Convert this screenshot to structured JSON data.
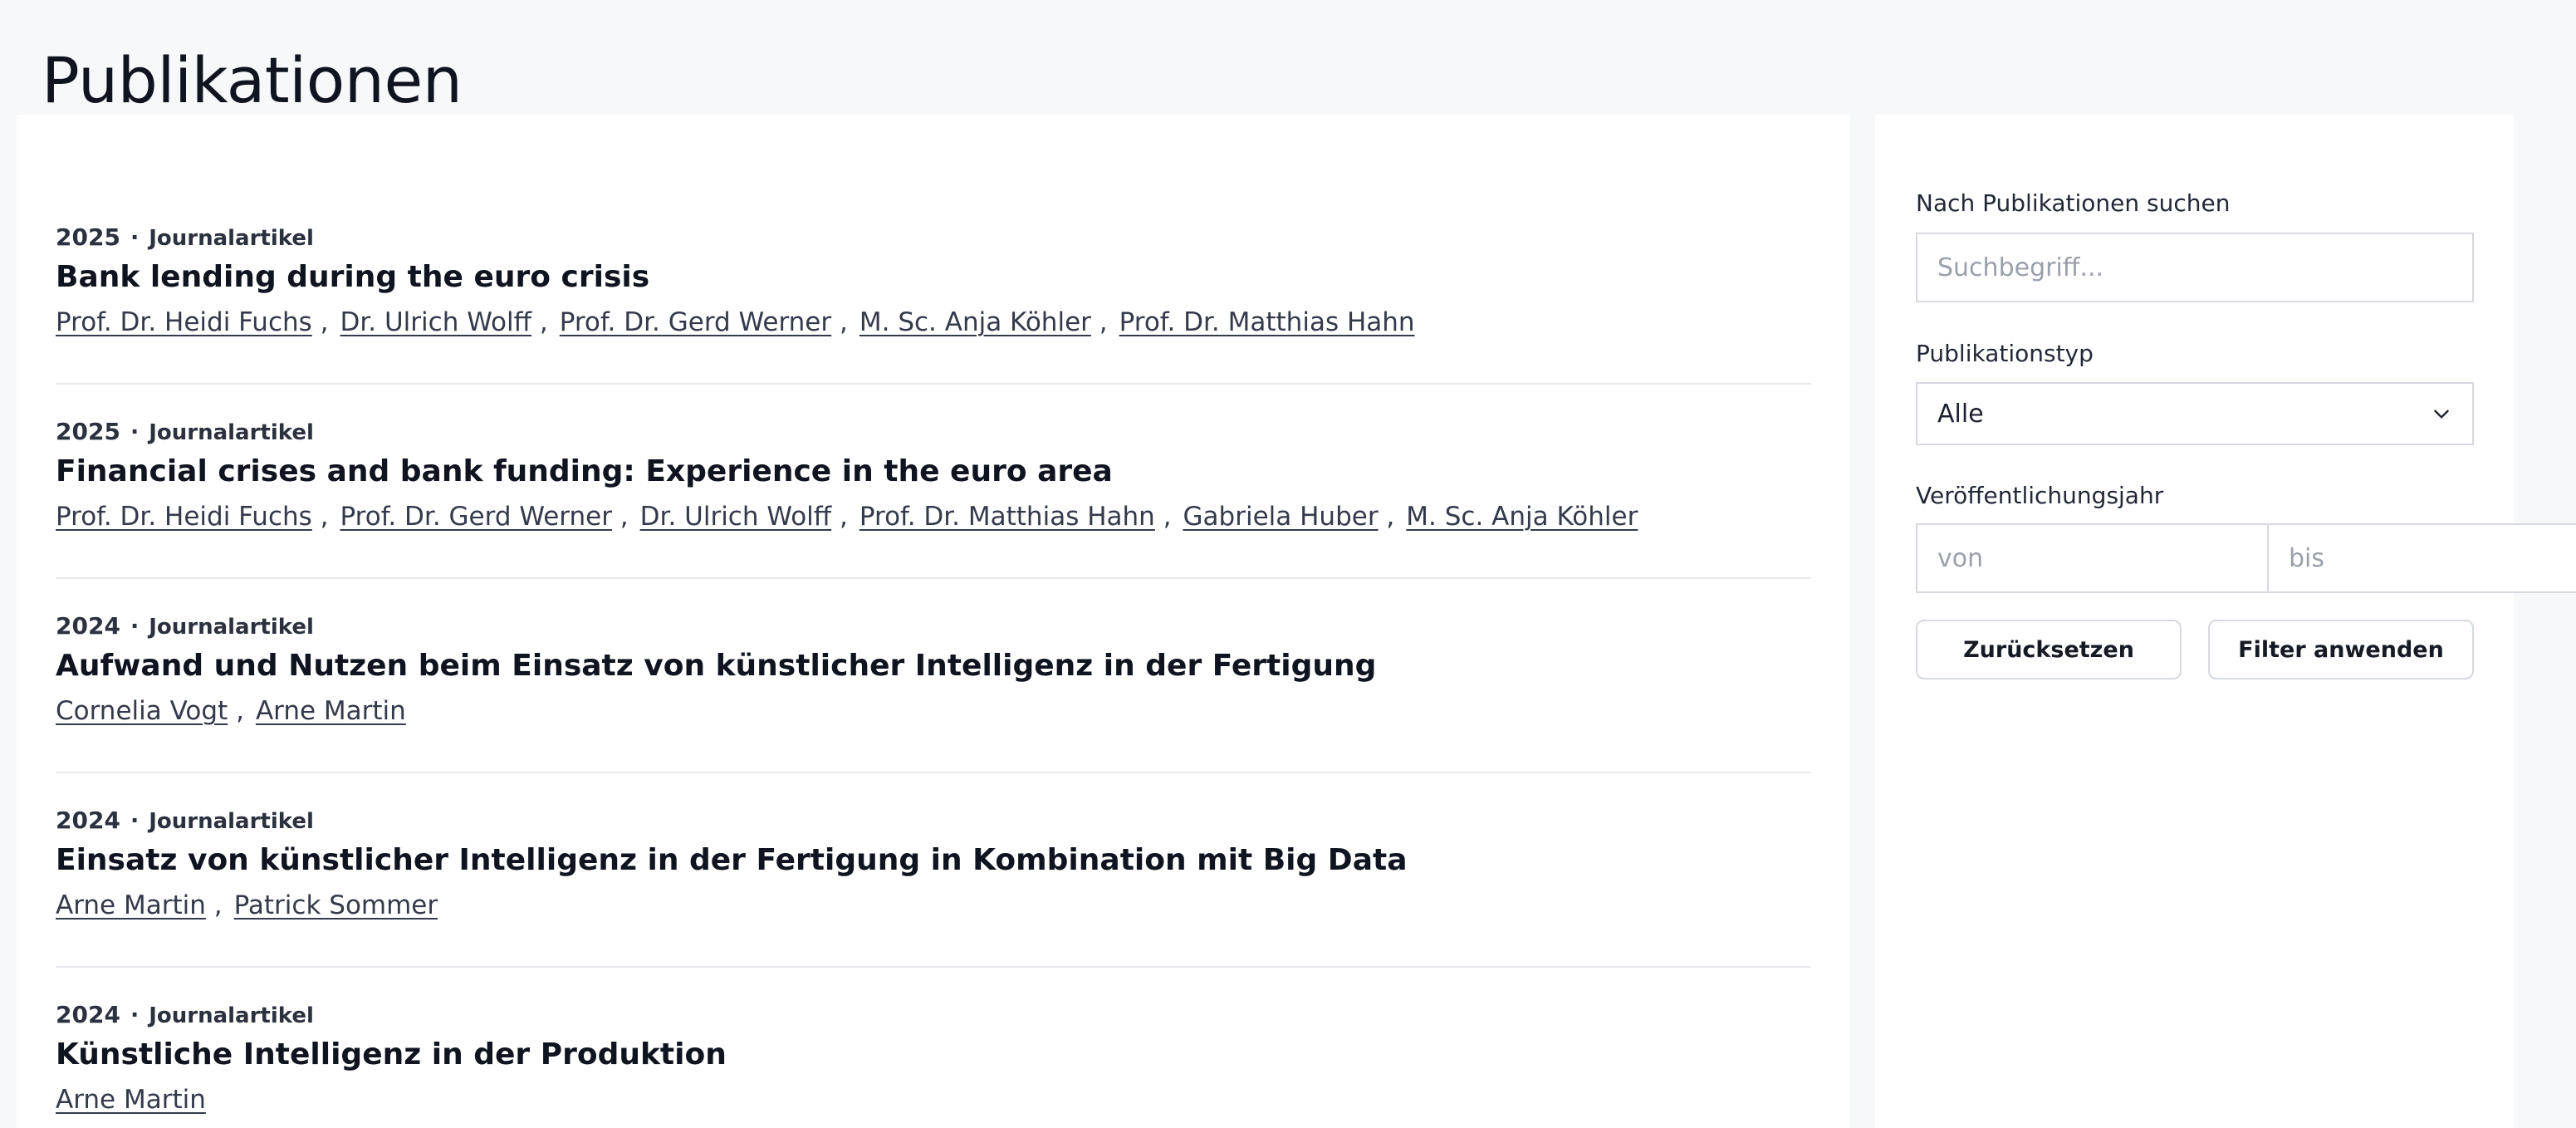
{
  "page": {
    "title": "Publikationen"
  },
  "publications": [
    {
      "year": "2025",
      "type": "Journalartikel",
      "title": "Bank lending during the euro crisis",
      "authors": [
        "Prof. Dr. Heidi Fuchs",
        "Dr. Ulrich Wolff",
        "Prof. Dr. Gerd Werner",
        "M. Sc. Anja Köhler",
        "Prof. Dr. Matthias Hahn"
      ]
    },
    {
      "year": "2025",
      "type": "Journalartikel",
      "title": "Financial crises and bank funding: Experience in the euro area",
      "authors": [
        "Prof. Dr. Heidi Fuchs",
        "Prof. Dr. Gerd Werner",
        "Dr. Ulrich Wolff",
        "Prof. Dr. Matthias Hahn",
        "Gabriela Huber",
        "M. Sc. Anja Köhler"
      ]
    },
    {
      "year": "2024",
      "type": "Journalartikel",
      "title": "Aufwand und Nutzen beim Einsatz von künstlicher Intelligenz in der Fertigung",
      "authors": [
        "Cornelia Vogt",
        "Arne Martin"
      ]
    },
    {
      "year": "2024",
      "type": "Journalartikel",
      "title": "Einsatz von künstlicher Intelligenz in der Fertigung in Kombination mit Big Data",
      "authors": [
        "Arne Martin",
        "Patrick Sommer"
      ]
    },
    {
      "year": "2024",
      "type": "Journalartikel",
      "title": "Künstliche Intelligenz in der Produktion",
      "authors": [
        "Arne Martin"
      ]
    }
  ],
  "filters": {
    "search": {
      "label": "Nach Publikationen suchen",
      "placeholder": "Suchbegriff...",
      "value": ""
    },
    "type": {
      "label": "Publikationstyp",
      "selected": "Alle",
      "icon": "chevron-down-icon"
    },
    "year": {
      "label": "Veröffentlichungsjahr",
      "from_placeholder": "von",
      "to_placeholder": "bis"
    },
    "reset_label": "Zurücksetzen",
    "apply_label": "Filter anwenden"
  },
  "colors": {
    "background": "#f7f8fa",
    "panel": "#ffffff",
    "text": "#151a24",
    "border": "#d6d9df"
  }
}
